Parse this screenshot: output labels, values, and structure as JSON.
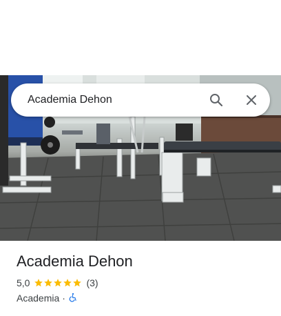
{
  "search": {
    "query": "Academia Dehon"
  },
  "place": {
    "name": "Academia Dehon",
    "rating": "5,0",
    "stars": 5,
    "review_count": "(3)",
    "category": "Academia",
    "separator": "·",
    "accessibility_icon": "wheelchair-icon"
  },
  "colors": {
    "star": "#fbbc04",
    "accessibility": "#1a73e8",
    "text_primary": "#202124",
    "text_secondary": "#3c4043"
  },
  "icons": {
    "search": "search-icon",
    "close": "close-icon"
  }
}
